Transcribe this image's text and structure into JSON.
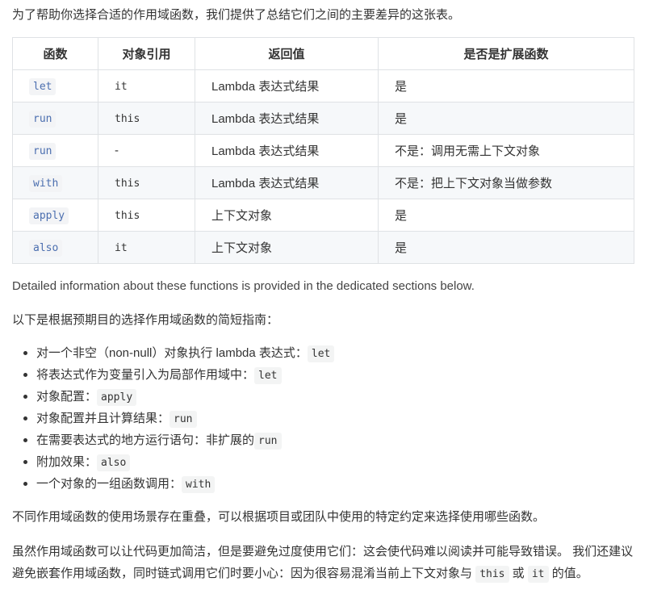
{
  "intro": "为了帮助你选择合适的作用域函数，我们提供了总结它们之间的主要差异的这张表。",
  "table": {
    "headers": [
      "函数",
      "对象引用",
      "返回值",
      "是否是扩展函数"
    ],
    "rows": [
      {
        "fn": "let",
        "obj": "it",
        "ret": "Lambda 表达式结果",
        "ext": "是"
      },
      {
        "fn": "run",
        "obj": "this",
        "ret": "Lambda 表达式结果",
        "ext": "是"
      },
      {
        "fn": "run",
        "obj": "-",
        "ret": "Lambda 表达式结果",
        "ext": "不是：调用无需上下文对象"
      },
      {
        "fn": "with",
        "obj": "this",
        "ret": "Lambda 表达式结果",
        "ext": "不是：把上下文对象当做参数"
      },
      {
        "fn": "apply",
        "obj": "this",
        "ret": "上下文对象",
        "ext": "是"
      },
      {
        "fn": "also",
        "obj": "it",
        "ret": "上下文对象",
        "ext": "是"
      }
    ]
  },
  "detail": "Detailed information about these functions is provided in the dedicated sections below.",
  "guide_intro": "以下是根据预期目的选择作用域函数的简短指南：",
  "guide": [
    {
      "text": "对一个非空（non-null）对象执行 lambda 表达式：",
      "code": "let"
    },
    {
      "text": "将表达式作为变量引入为局部作用域中：",
      "code": "let"
    },
    {
      "text": "对象配置：",
      "code": "apply"
    },
    {
      "text": "对象配置并且计算结果：",
      "code": "run"
    },
    {
      "text": "在需要表达式的地方运行语句：非扩展的",
      "code": "run"
    },
    {
      "text": "附加效果：",
      "code": "also"
    },
    {
      "text": "一个对象的一组函数调用：",
      "code": "with"
    }
  ],
  "overlap": "不同作用域函数的使用场景存在重叠，可以根据项目或团队中使用的特定约定来选择使用哪些函数。",
  "caution": {
    "part1": "虽然作用域函数可以让代码更加简洁，但是要避免过度使用它们：这会使代码难以阅读并可能导致错误。 我们还建议避免嵌套作用域函数，同时链式调用它们时要小心：因为很容易混淆当前上下文对象与",
    "code1": "this",
    "part2": "或",
    "code2": "it",
    "part3": "的值。"
  }
}
